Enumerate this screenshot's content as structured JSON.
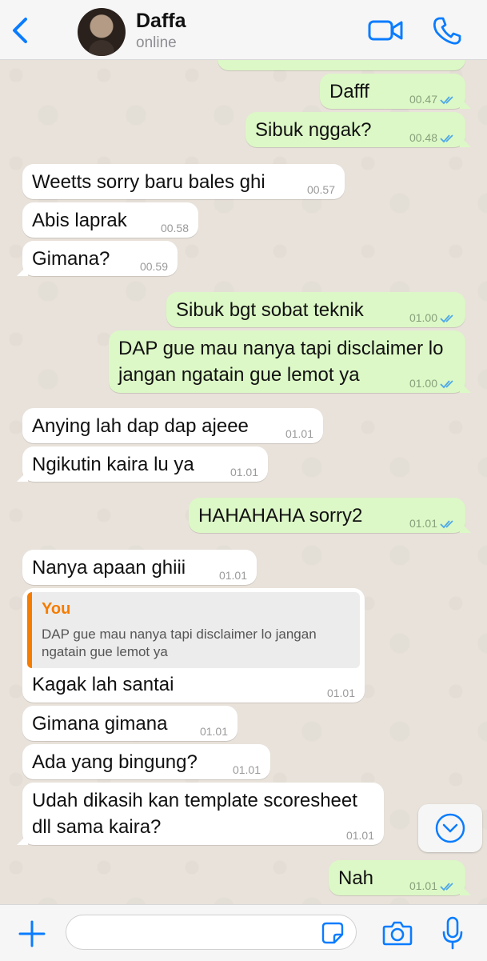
{
  "header": {
    "back_label": "<",
    "contact_name": "Daffa",
    "contact_status": "online"
  },
  "messages": [
    {
      "dir": "out",
      "text": "Dafff",
      "time": "00.47",
      "ticks": "read"
    },
    {
      "dir": "out",
      "text": "Sibuk nggak?",
      "time": "00.48",
      "ticks": "read"
    },
    {
      "dir": "in",
      "text": "Weetts sorry baru bales ghi",
      "time": "00.57"
    },
    {
      "dir": "in",
      "text": "Abis laprak",
      "time": "00.58"
    },
    {
      "dir": "in",
      "text": "Gimana?",
      "time": "00.59"
    },
    {
      "dir": "out",
      "text": "Sibuk bgt sobat teknik",
      "time": "01.00",
      "ticks": "read"
    },
    {
      "dir": "out",
      "text": "DAP gue mau nanya tapi disclaimer lo jangan ngatain gue lemot ya",
      "time": "01.00",
      "ticks": "read"
    },
    {
      "dir": "in",
      "text": "Anying lah dap dap ajeee",
      "time": "01.01"
    },
    {
      "dir": "in",
      "text": "Ngikutin kaira lu ya",
      "time": "01.01"
    },
    {
      "dir": "out",
      "text": "HAHAHAHA sorry2",
      "time": "01.01",
      "ticks": "read"
    },
    {
      "dir": "in",
      "text": "Nanya apaan ghiii",
      "time": "01.01"
    },
    {
      "dir": "in",
      "text": "Kagak lah santai",
      "time": "01.01",
      "quote": {
        "author": "You",
        "text": "DAP gue mau nanya tapi disclaimer lo jangan ngatain gue lemot ya"
      }
    },
    {
      "dir": "in",
      "text": "Gimana gimana",
      "time": "01.01"
    },
    {
      "dir": "in",
      "text": "Ada yang bingung?",
      "time": "01.01"
    },
    {
      "dir": "in",
      "text": "Udah dikasih kan template scoresheet dll sama kaira?",
      "time": "01.01"
    },
    {
      "dir": "out",
      "text": "Nah",
      "time": "01.01",
      "ticks": "read"
    }
  ],
  "composer": {
    "placeholder": "",
    "icons": [
      "plus-icon",
      "sticker-icon",
      "camera-icon",
      "microphone-icon"
    ]
  },
  "colors": {
    "accent": "#0a7cff",
    "outgoing_bubble": "#dcf8c6",
    "incoming_bubble": "#ffffff",
    "read_ticks": "#4fa8e8",
    "quote_author": "#f57c00"
  }
}
